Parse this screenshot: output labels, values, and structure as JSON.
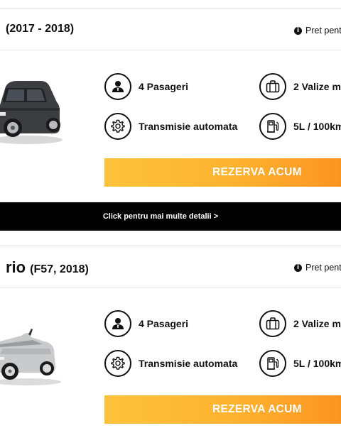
{
  "cars": [
    {
      "model": "",
      "years": "(2017 - 2018)",
      "price_note": "Pret pent",
      "features": {
        "passengers": "4 Pasageri",
        "luggage": "2 Valize m",
        "transmission": "Transmisie automata",
        "consumption": "5L / 100km"
      },
      "reserve_label": "REZERVA ACUM",
      "car_color": "#3c3d41"
    },
    {
      "model": "rio",
      "years": "(F57, 2018)",
      "price_note": "Pret pent",
      "features": {
        "passengers": "4 Pasageri",
        "luggage": "2 Valize m",
        "transmission": "Transmisie automata",
        "consumption": "5L / 100km"
      },
      "reserve_label": "REZERVA ACUM",
      "car_color": "#c9cacc"
    }
  ],
  "details_link": "Click pentru mai multe detalii >",
  "colors": {
    "button_gradient_start": "#fcc13a",
    "button_gradient_end": "#fd9422",
    "details_bar_bg": "#000000"
  },
  "icons": {
    "passengers": "person-icon",
    "luggage": "suitcase-icon",
    "transmission": "gear-icon",
    "consumption": "fuel-pump-icon",
    "info": "info-icon"
  }
}
